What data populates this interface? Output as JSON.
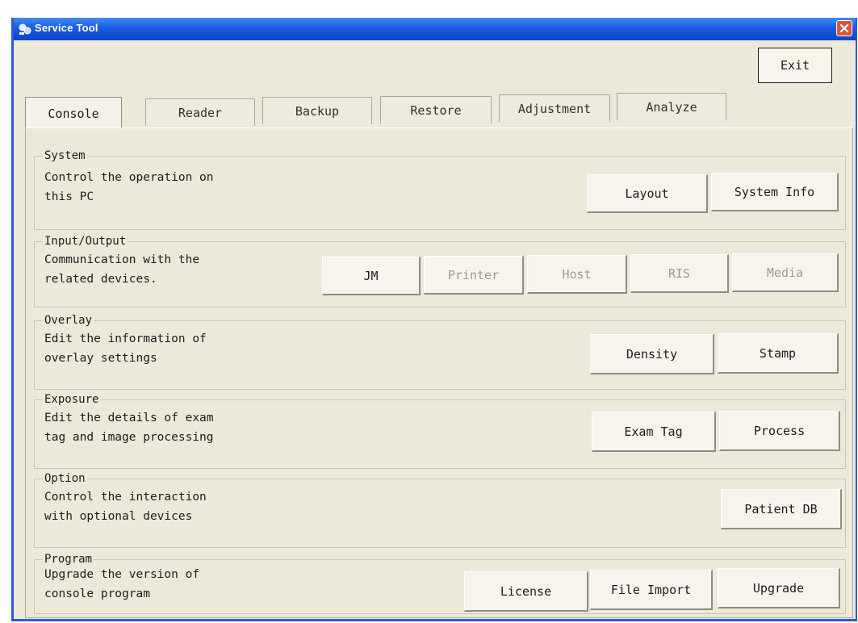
{
  "window": {
    "title": "Service Tool"
  },
  "toolbar": {
    "exit_label": "Exit"
  },
  "tabs": [
    {
      "label": "Console",
      "active": true
    },
    {
      "label": "Reader"
    },
    {
      "label": "Backup"
    },
    {
      "label": "Restore"
    },
    {
      "label": "Adjustment"
    },
    {
      "label": "Analyze"
    }
  ],
  "sections": {
    "system": {
      "title": "System",
      "desc1": "Control the operation on",
      "desc2": "this PC",
      "buttons": {
        "layout": "Layout",
        "system_info": "System Info"
      }
    },
    "io": {
      "title": "Input/Output",
      "desc1": "Communication with the",
      "desc2": "related devices.",
      "buttons": {
        "jm": "JM",
        "printer": "Printer",
        "host": "Host",
        "ris": "RIS",
        "media": "Media"
      }
    },
    "overlay": {
      "title": "Overlay",
      "desc1": "Edit the information of",
      "desc2": "overlay settings",
      "buttons": {
        "density": "Density",
        "stamp": "Stamp"
      }
    },
    "exposure": {
      "title": "Exposure",
      "desc1": "Edit the details of exam",
      "desc2": "tag and image processing",
      "buttons": {
        "exam_tag": "Exam Tag",
        "process": "Process"
      }
    },
    "option": {
      "title": "Option",
      "desc1": "Control the interaction",
      "desc2": "with optional devices",
      "buttons": {
        "patient_db": "Patient DB"
      }
    },
    "program": {
      "title": "Program",
      "desc1": "Upgrade the version of",
      "desc2": "console program",
      "buttons": {
        "license": "License",
        "file_import": "File Import",
        "upgrade": "Upgrade"
      }
    }
  },
  "colors": {
    "titlebar": "#1c5ae0",
    "window_bg": "#ece9d8",
    "close": "#d9583b"
  },
  "icons": {
    "app": "service-tool-icon",
    "close": "close-icon"
  }
}
